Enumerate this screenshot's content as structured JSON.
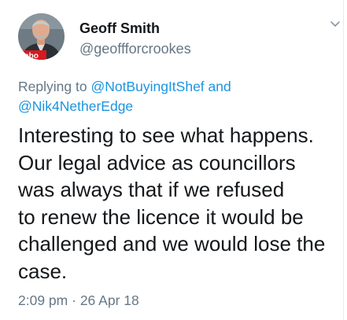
{
  "author": {
    "display_name": "Geoff Smith",
    "handle": "@geoffforcrookes",
    "avatar_badge_text": "Labo"
  },
  "reply": {
    "prefix": "Replying to",
    "mention_1": "@NotBuyingItShef",
    "conjunction": "and",
    "mention_2": "@Nik4NetherEdge"
  },
  "tweet": {
    "lines": [
      "Interesting to see what happens.",
      "Our legal advice as councillors",
      "was always that if we refused",
      "to renew the licence it would be",
      "challenged and we would lose the",
      "case."
    ],
    "time": "2:09 pm",
    "separator": "·",
    "date": "26 Apr 18"
  },
  "icons": {
    "chevron": "chevron-down-icon"
  },
  "colors": {
    "link": "#1b95e0",
    "secondary_text": "#657786",
    "primary_text": "#14171a",
    "badge_red": "#d71920"
  }
}
